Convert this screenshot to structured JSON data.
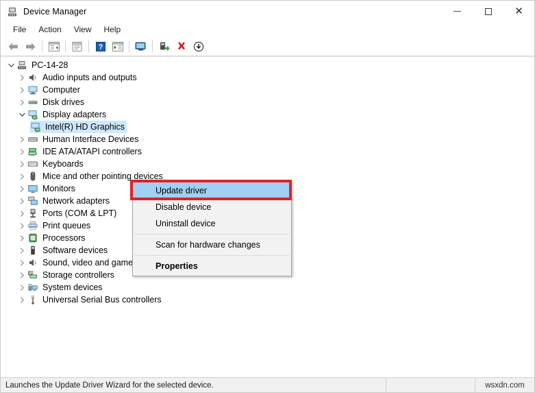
{
  "window": {
    "title": "Device Manager",
    "title_icon": "device-manager-icon",
    "minimize_label": "Minimize",
    "maximize_label": "Maximize",
    "close_label": "Close"
  },
  "menubar": {
    "items": [
      {
        "label": "File",
        "name": "menu-file"
      },
      {
        "label": "Action",
        "name": "menu-action"
      },
      {
        "label": "View",
        "name": "menu-view"
      },
      {
        "label": "Help",
        "name": "menu-help"
      }
    ]
  },
  "toolbar": {
    "buttons": [
      {
        "icon": "back-arrow-icon",
        "label": "Back"
      },
      {
        "icon": "forward-arrow-icon",
        "label": "Forward"
      },
      {
        "icon": "show-hide-console-tree-icon",
        "label": "Show/Hide Console Tree"
      },
      {
        "icon": "properties-icon",
        "label": "Properties"
      },
      {
        "icon": "help-icon",
        "label": "Help"
      },
      {
        "icon": "update-driver-icon",
        "label": "Update Driver Software"
      },
      {
        "icon": "scan-hardware-changes-icon",
        "label": "Scan for hardware changes"
      },
      {
        "icon": "enable-device-icon",
        "label": "Enable device"
      },
      {
        "icon": "uninstall-device-icon",
        "label": "Uninstall device"
      },
      {
        "icon": "disable-device-icon",
        "label": "Disable device"
      }
    ]
  },
  "tree": {
    "root": {
      "label": "PC-14-28",
      "icon": "computer-icon",
      "expanded": true
    },
    "nodes": [
      {
        "label": "Audio inputs and outputs",
        "icon": "speaker-icon",
        "expanded": false,
        "indent": 1
      },
      {
        "label": "Computer",
        "icon": "monitor-icon",
        "expanded": false,
        "indent": 1
      },
      {
        "label": "Disk drives",
        "icon": "disk-icon",
        "expanded": false,
        "indent": 1
      },
      {
        "label": "Display adapters",
        "icon": "display-adapter-icon",
        "expanded": true,
        "indent": 1
      },
      {
        "label": "Intel(R) HD Graphics",
        "icon": "display-adapter-icon",
        "expanded": null,
        "indent": 2,
        "selected": true
      },
      {
        "label": "Human Interface Devices",
        "icon": "hid-icon",
        "expanded": false,
        "indent": 1
      },
      {
        "label": "IDE ATA/ATAPI controllers",
        "icon": "ide-controller-icon",
        "expanded": false,
        "indent": 1
      },
      {
        "label": "Keyboards",
        "icon": "keyboard-icon",
        "expanded": false,
        "indent": 1
      },
      {
        "label": "Mice and other pointing devices",
        "icon": "mouse-icon",
        "expanded": false,
        "indent": 1
      },
      {
        "label": "Monitors",
        "icon": "monitor-icon",
        "expanded": false,
        "indent": 1
      },
      {
        "label": "Network adapters",
        "icon": "network-adapter-icon",
        "expanded": false,
        "indent": 1
      },
      {
        "label": "Ports (COM & LPT)",
        "icon": "port-icon",
        "expanded": false,
        "indent": 1
      },
      {
        "label": "Print queues",
        "icon": "printer-icon",
        "expanded": false,
        "indent": 1
      },
      {
        "label": "Processors",
        "icon": "processor-icon",
        "expanded": false,
        "indent": 1
      },
      {
        "label": "Software devices",
        "icon": "software-device-icon",
        "expanded": false,
        "indent": 1
      },
      {
        "label": "Sound, video and game controllers",
        "icon": "speaker-icon",
        "expanded": false,
        "indent": 1
      },
      {
        "label": "Storage controllers",
        "icon": "storage-controller-icon",
        "expanded": false,
        "indent": 1
      },
      {
        "label": "System devices",
        "icon": "system-device-icon",
        "expanded": false,
        "indent": 1
      },
      {
        "label": "Universal Serial Bus controllers",
        "icon": "usb-icon",
        "expanded": false,
        "indent": 1
      }
    ]
  },
  "context_menu": {
    "items": [
      {
        "label": "Update driver",
        "highlighted": true,
        "bold": false,
        "separator_before": false
      },
      {
        "label": "Disable device",
        "highlighted": false,
        "bold": false,
        "separator_before": false
      },
      {
        "label": "Uninstall device",
        "highlighted": false,
        "bold": false,
        "separator_before": false
      },
      {
        "label": "Scan for hardware changes",
        "highlighted": false,
        "bold": false,
        "separator_before": true
      },
      {
        "label": "Properties",
        "highlighted": false,
        "bold": true,
        "separator_before": true
      }
    ]
  },
  "statusbar": {
    "message": "Launches the Update Driver Wizard for the selected device.",
    "watermark": "wsxdn.com"
  },
  "colors": {
    "highlight_blue": "#9fd0f5",
    "selection_blue": "#cde8ff",
    "annotation_red": "#e32124",
    "menu_bg": "#f2f2f2",
    "status_bg": "#f0f0f0"
  }
}
